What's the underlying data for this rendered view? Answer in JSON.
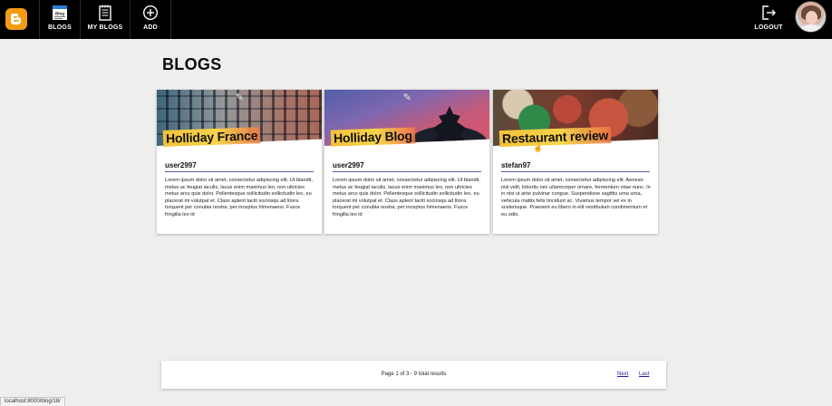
{
  "nav": {
    "blogs_label": "BLOGS",
    "my_blogs_label": "MY BLOGS",
    "add_label": "ADD",
    "logout_label": "LOGOUT"
  },
  "page": {
    "title": "BLOGS"
  },
  "cards": [
    {
      "title": "Holliday France",
      "author": "user2997",
      "body": "Lorem ipsum dolor sit amet, consectetur adipiscing elit. Ut blandit, metus ac feugiat iaculis, lacus enim maximus leo, non ultricies metus arcu quis dolor. Pellentesque sollicitudin sollicitudin leo, eu placerat mi volutpat et. Class aptent taciti sociosqu ad litora torquent per conubia nostra, per inceptos himenaeos. Fusce fringilla leo id"
    },
    {
      "title": "Holliday Blog",
      "author": "user2997",
      "body": "Lorem ipsum dolor sit amet, consectetur adipiscing elit. Ut blandit, metus ac feugiat iaculis, lacus enim maximus leo, non ultricies metus arcu quis dolor. Pellentesque sollicitudin sollicitudin leo, eu placerat mi volutpat et. Class aptent taciti sociosqu ad litora torquent per conubia nostra, per inceptos himenaeos. Fusce fringilla leo id"
    },
    {
      "title": "Restaurant review",
      "author": "stefan97",
      "body": "Lorem ipsum dolor sit amet, consectetur adipiscing elit. Aenean nisl velit, lobortis nec ullamcorper ornare, fermentum vitae nunc. In in nisi ut ante pulvinar congue. Suspendisse sagittis urna urna, vehicula mattis felis tincidunt ac. Vivamus tempor vel ex in scelerisque. Praesent eu libero in elit vestibulum condimentum et eu odio."
    }
  ],
  "pagination": {
    "info": "Page 1 of 3 - 9 total results",
    "next_label": "Next",
    "last_label": "Last"
  },
  "status_bar": {
    "url": "localhost:8000/blog/18/"
  },
  "icons": {
    "logo": "blogger-logo-icon",
    "blogs": "blog-newspaper-icon",
    "my_blogs": "notebook-icon",
    "add": "plus-circle-icon",
    "logout": "logout-arrow-icon",
    "edit": "pencil-icon"
  },
  "colors": {
    "brand": "#f39c12",
    "topbar": "#000000",
    "link": "#1a1aa6",
    "title_highlight": "#f2c13a"
  }
}
